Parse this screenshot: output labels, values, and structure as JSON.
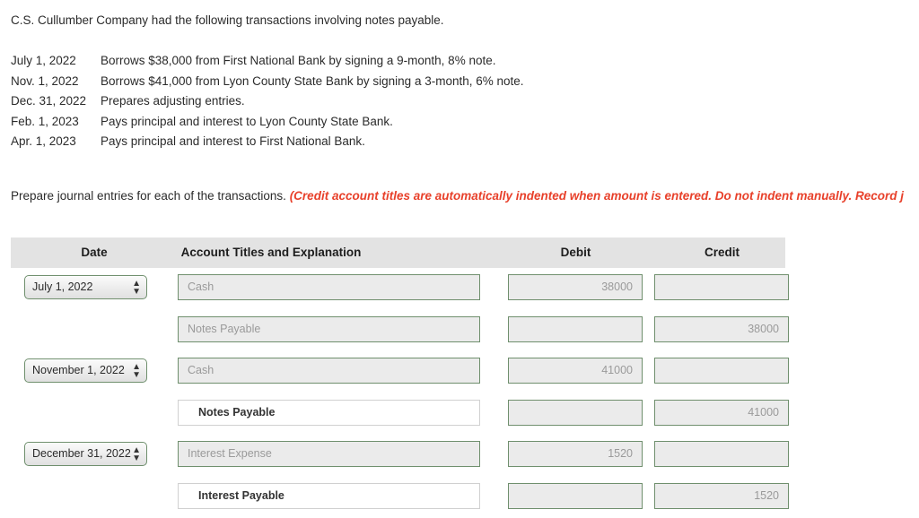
{
  "problem": {
    "intro": "C.S. Cullumber Company had the following transactions involving notes payable.",
    "transactions": [
      {
        "date": "July 1, 2022",
        "description": "Borrows $38,000 from First National Bank by signing a 9-month, 8% note."
      },
      {
        "date": "Nov. 1, 2022",
        "description": "Borrows $41,000 from Lyon County State Bank by signing a 3-month, 6% note."
      },
      {
        "date": "Dec. 31, 2022",
        "description": "Prepares adjusting entries."
      },
      {
        "date": "Feb. 1, 2023",
        "description": "Pays principal and interest to Lyon County State Bank."
      },
      {
        "date": "Apr. 1, 2023",
        "description": "Pays principal and interest to First National Bank."
      }
    ]
  },
  "instruction": {
    "main": "Prepare journal entries for each of the transactions.",
    "note": "(Credit account titles are automatically indented when amount is entered. Do not indent manually. Record j"
  },
  "journal": {
    "headers": {
      "date": "Date",
      "account": "Account Titles and Explanation",
      "debit": "Debit",
      "credit": "Credit"
    },
    "rows": [
      {
        "date": "July 1, 2022",
        "account": "Cash",
        "account_state": "placeholder",
        "debit": "38000",
        "credit": ""
      },
      {
        "date": "",
        "account": "Notes Payable",
        "account_state": "placeholder",
        "debit": "",
        "credit": "38000"
      },
      {
        "date": "November 1, 2022",
        "account": "Cash",
        "account_state": "placeholder",
        "debit": "41000",
        "credit": ""
      },
      {
        "date": "",
        "account": "Notes Payable",
        "account_state": "filled",
        "debit": "",
        "credit": "41000"
      },
      {
        "date": "December 31, 2022",
        "account": "Interest Expense",
        "account_state": "placeholder",
        "debit": "1520",
        "credit": ""
      },
      {
        "date": "",
        "account": "Interest Payable",
        "account_state": "filled",
        "debit": "",
        "credit": "1520"
      }
    ],
    "stepper_up": "▲",
    "stepper_down": "▼"
  }
}
